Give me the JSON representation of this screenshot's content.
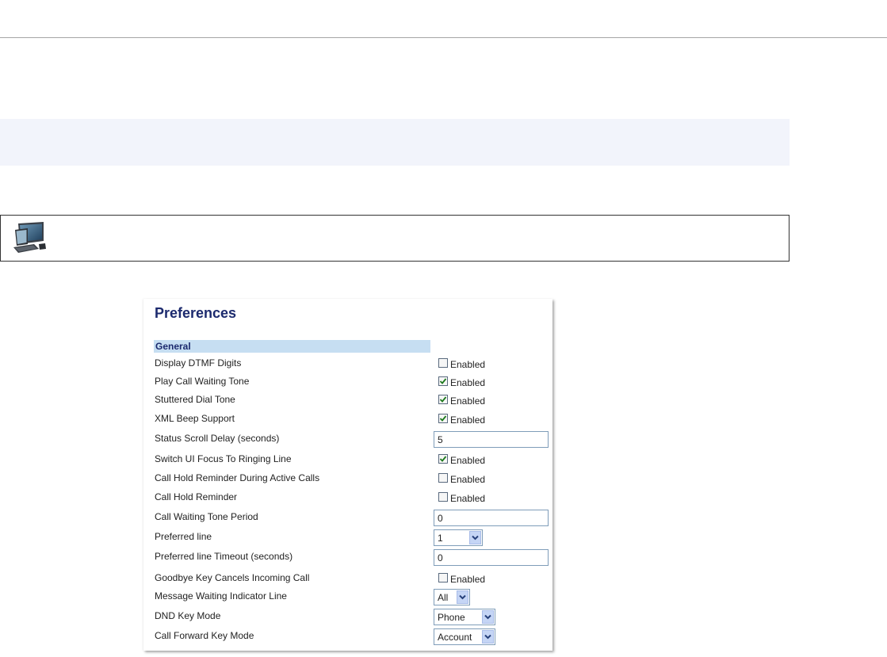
{
  "panel": {
    "title": "Preferences",
    "section": "General",
    "rows": [
      {
        "label": "Display DTMF Digits",
        "type": "checkbox",
        "checked": false,
        "option_label": "Enabled"
      },
      {
        "label": "Play Call Waiting Tone",
        "type": "checkbox",
        "checked": true,
        "option_label": "Enabled"
      },
      {
        "label": "Stuttered Dial Tone",
        "type": "checkbox",
        "checked": true,
        "option_label": "Enabled"
      },
      {
        "label": "XML Beep Support",
        "type": "checkbox",
        "checked": true,
        "option_label": "Enabled"
      },
      {
        "label": "Status Scroll Delay (seconds)",
        "type": "text",
        "value": "5"
      },
      {
        "label": "Switch UI Focus To Ringing Line",
        "type": "checkbox",
        "checked": true,
        "option_label": "Enabled"
      },
      {
        "label": "Call Hold Reminder During Active Calls",
        "type": "checkbox",
        "checked": false,
        "option_label": "Enabled"
      },
      {
        "label": "Call Hold Reminder",
        "type": "checkbox",
        "checked": false,
        "option_label": "Enabled"
      },
      {
        "label": "Call Waiting Tone Period",
        "type": "text",
        "value": "0"
      },
      {
        "label": "Preferred line",
        "type": "select",
        "value": "1"
      },
      {
        "label": "Preferred line Timeout (seconds)",
        "type": "text",
        "value": "0"
      },
      {
        "label": "Goodbye Key Cancels Incoming Call",
        "type": "checkbox",
        "checked": false,
        "option_label": "Enabled"
      },
      {
        "label": "Message Waiting Indicator Line",
        "type": "select",
        "value": "All"
      },
      {
        "label": "DND Key Mode",
        "type": "select",
        "value": "Phone"
      },
      {
        "label": "Call Forward Key Mode",
        "type": "select",
        "value": "Account"
      }
    ]
  },
  "colors": {
    "title": "#1c2a6e",
    "section_bg": "#c6def2",
    "note_band": "#f2f4fb",
    "check": "#1d7a1d"
  },
  "icons": {
    "web_ui": "computer-monitor-icon",
    "dropdown": "chevron-down-icon",
    "check": "checkmark-icon"
  }
}
